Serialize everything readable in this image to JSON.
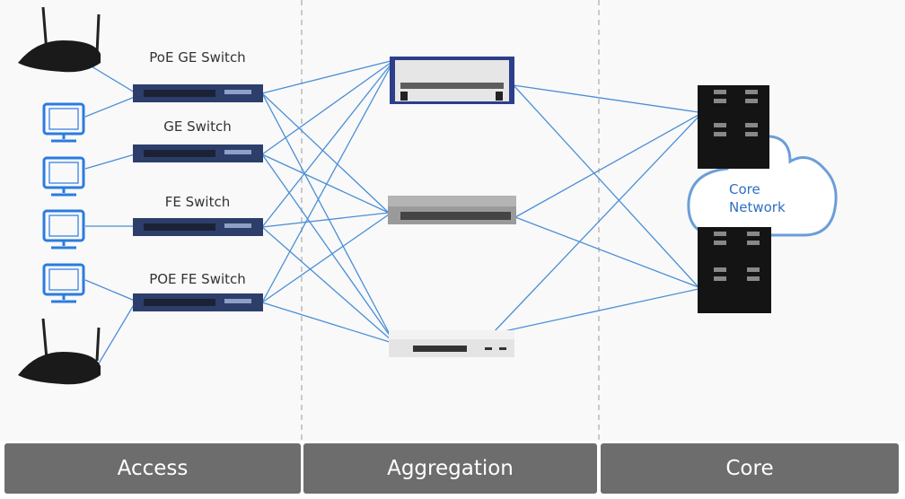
{
  "access": {
    "switch_labels": [
      "PoE GE Switch",
      "GE Switch",
      "FE Switch",
      "POE FE Switch"
    ]
  },
  "cloud": {
    "line1": "Core",
    "line2": "Network"
  },
  "tiers": [
    "Access",
    "Aggregation",
    "Core"
  ],
  "colors": {
    "link": "#4a8fd6",
    "monitor": "#2b7be0",
    "tier_bar": "#6d6d6d",
    "cloud_text": "#2e6fc4",
    "background": "#f9f9f9"
  },
  "icons": [
    "wireless-router-icon",
    "monitor-icon",
    "access-switch-icon",
    "chassis-switch-icon",
    "aggregation-switch-icon",
    "core-router-icon",
    "cloud-icon"
  ]
}
